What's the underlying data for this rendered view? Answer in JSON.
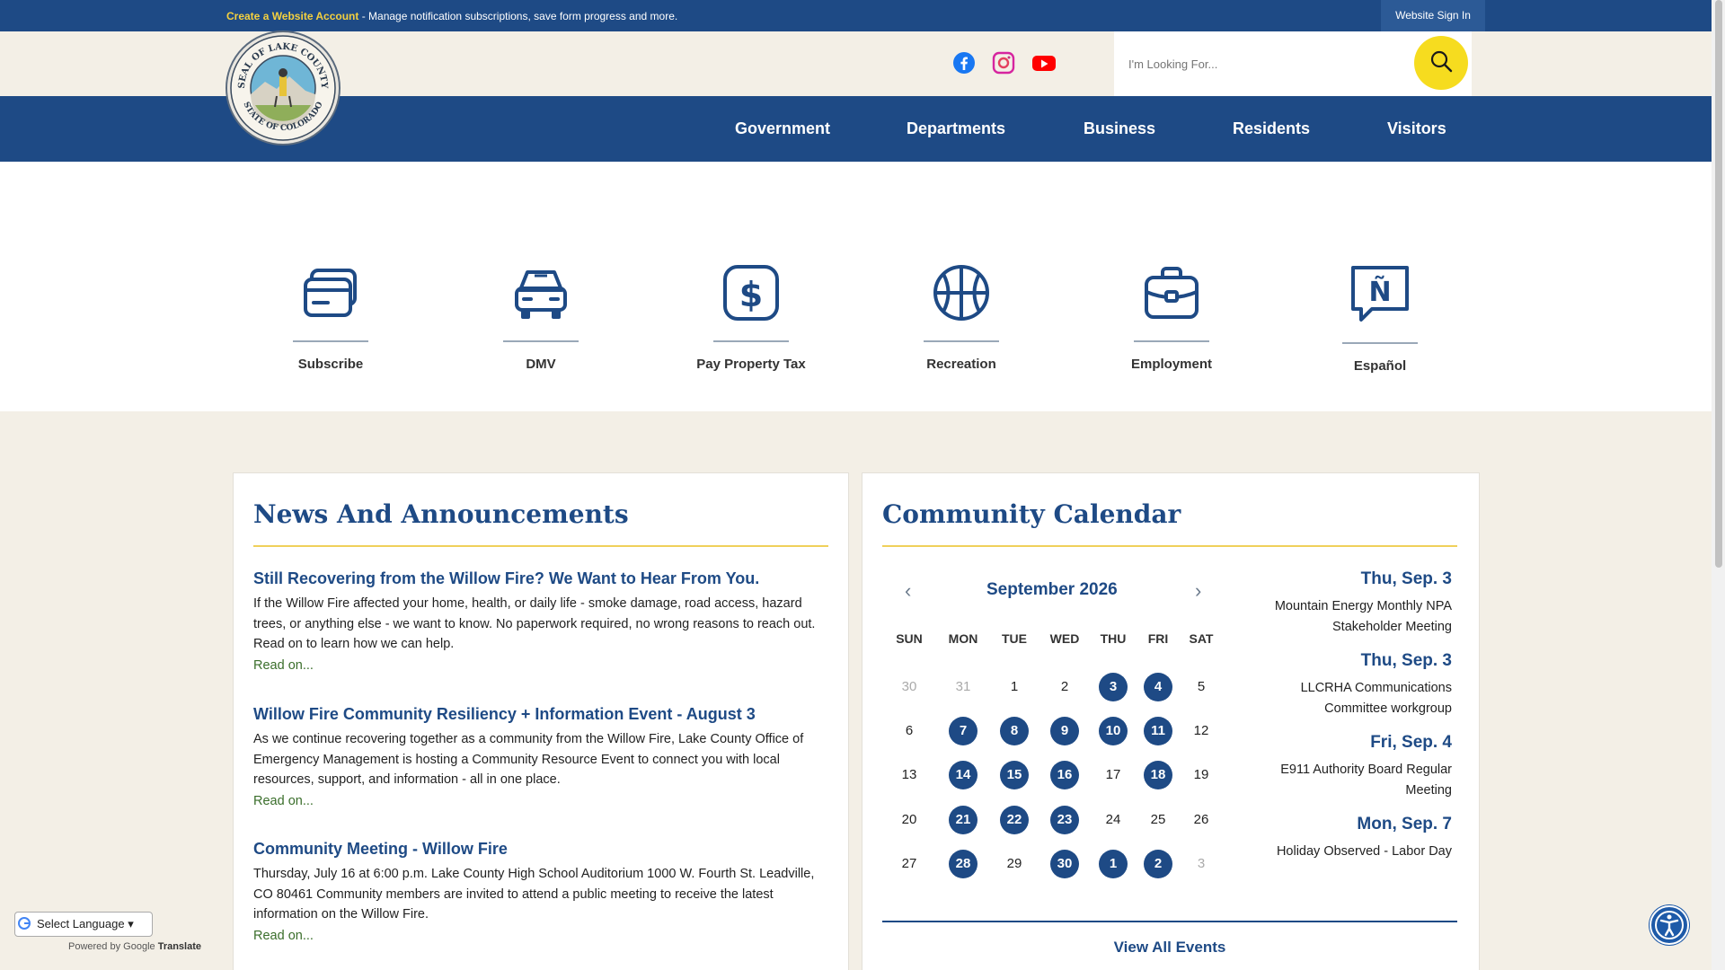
{
  "topbar": {
    "create_account_link": "Create a Website Account",
    "create_account_desc": " - Manage notification subscriptions, save form progress and more.",
    "sign_in": "Website Sign In"
  },
  "header": {
    "seal_text_top": "SEAL OF LAKE COUNTY",
    "seal_text_bottom": "STATE OF COLORADO",
    "social": [
      {
        "icon": "facebook-icon",
        "color": "#1877f2"
      },
      {
        "icon": "instagram-icon",
        "color": "#d6249f"
      },
      {
        "icon": "youtube-icon",
        "color": "#ff0000"
      }
    ],
    "search_placeholder": "I'm Looking For..."
  },
  "nav": {
    "items": [
      "Government",
      "Departments",
      "Business",
      "Residents",
      "Visitors"
    ]
  },
  "quick_links": [
    {
      "label": "Subscribe",
      "icon": "credit-card-icon"
    },
    {
      "label": "DMV",
      "icon": "car-icon"
    },
    {
      "label": "Pay Property Tax",
      "icon": "dollar-icon"
    },
    {
      "label": "Recreation",
      "icon": "basketball-icon"
    },
    {
      "label": "Employment",
      "icon": "briefcase-icon"
    },
    {
      "label": "Español",
      "icon": "spanish-speech-icon"
    }
  ],
  "news": {
    "title": "News And Announcements",
    "items": [
      {
        "title": "Still Recovering from the Willow Fire? We Want to Hear From You.",
        "text": "If the Willow Fire affected your home, health, or daily life - smoke damage, road access, hazard trees, or anything else - we want to know. No paperwork required, no wrong reasons to reach out. Read on to learn how we can help.",
        "more": "Read on..."
      },
      {
        "title": "Willow Fire Community Resiliency + Information Event - August 3",
        "text": "As we continue recovering together as a community from the Willow Fire, Lake County Office of Emergency Management is hosting a Community Resource Event to connect you with local resources, support, and information - all in one place.",
        "more": "Read on..."
      },
      {
        "title": "Community Meeting - Willow Fire",
        "text": "Thursday, July 16 at 6:00 p.m. Lake County High School Auditorium 1000 W. Fourth St. Leadville, CO 80461 Community members are invited to attend a public meeting to receive the latest information on the Willow Fire.",
        "more": "Read on..."
      }
    ]
  },
  "calendar": {
    "title": "Community Calendar",
    "month": "September 2026",
    "prev": "‹",
    "next": "›",
    "dow": [
      "SUN",
      "MON",
      "TUE",
      "WED",
      "THU",
      "FRI",
      "SAT"
    ],
    "weeks": [
      [
        {
          "d": "30",
          "t": "other"
        },
        {
          "d": "31",
          "t": "other"
        },
        {
          "d": "1",
          "t": ""
        },
        {
          "d": "2",
          "t": ""
        },
        {
          "d": "3",
          "t": "ev"
        },
        {
          "d": "4",
          "t": "ev"
        },
        {
          "d": "5",
          "t": ""
        }
      ],
      [
        {
          "d": "6",
          "t": ""
        },
        {
          "d": "7",
          "t": "ev"
        },
        {
          "d": "8",
          "t": "ev"
        },
        {
          "d": "9",
          "t": "ev"
        },
        {
          "d": "10",
          "t": "ev"
        },
        {
          "d": "11",
          "t": "ev"
        },
        {
          "d": "12",
          "t": ""
        }
      ],
      [
        {
          "d": "13",
          "t": ""
        },
        {
          "d": "14",
          "t": "ev"
        },
        {
          "d": "15",
          "t": "ev"
        },
        {
          "d": "16",
          "t": "ev"
        },
        {
          "d": "17",
          "t": ""
        },
        {
          "d": "18",
          "t": "ev"
        },
        {
          "d": "19",
          "t": ""
        }
      ],
      [
        {
          "d": "20",
          "t": ""
        },
        {
          "d": "21",
          "t": "ev"
        },
        {
          "d": "22",
          "t": "ev"
        },
        {
          "d": "23",
          "t": "ev"
        },
        {
          "d": "24",
          "t": ""
        },
        {
          "d": "25",
          "t": ""
        },
        {
          "d": "26",
          "t": ""
        }
      ],
      [
        {
          "d": "27",
          "t": ""
        },
        {
          "d": "28",
          "t": "ev"
        },
        {
          "d": "29",
          "t": ""
        },
        {
          "d": "30",
          "t": "ev"
        },
        {
          "d": "1",
          "t": "ev"
        },
        {
          "d": "2",
          "t": "ev"
        },
        {
          "d": "3",
          "t": "other"
        }
      ]
    ],
    "events": [
      {
        "date": "Thu, Sep. 3",
        "name": "Mountain Energy Monthly NPA Stakeholder Meeting"
      },
      {
        "date": "Thu, Sep. 3",
        "name": "LLCRHA Communications Committee workgroup"
      },
      {
        "date": "Fri, Sep. 4",
        "name": "E911 Authority Board Regular Meeting"
      },
      {
        "date": "Mon, Sep. 7",
        "name": "Holiday Observed - Labor Day"
      }
    ],
    "view_all": "View All Events"
  },
  "translate": {
    "select_label": "Select Language",
    "powered": "Powered by",
    "brand": "Google",
    "translate_label": "Translate"
  },
  "colors": {
    "primary": "#1e4a85",
    "accent": "#f6dc1f",
    "cream": "#f3efe6",
    "link_green": "#3a6e2b"
  }
}
